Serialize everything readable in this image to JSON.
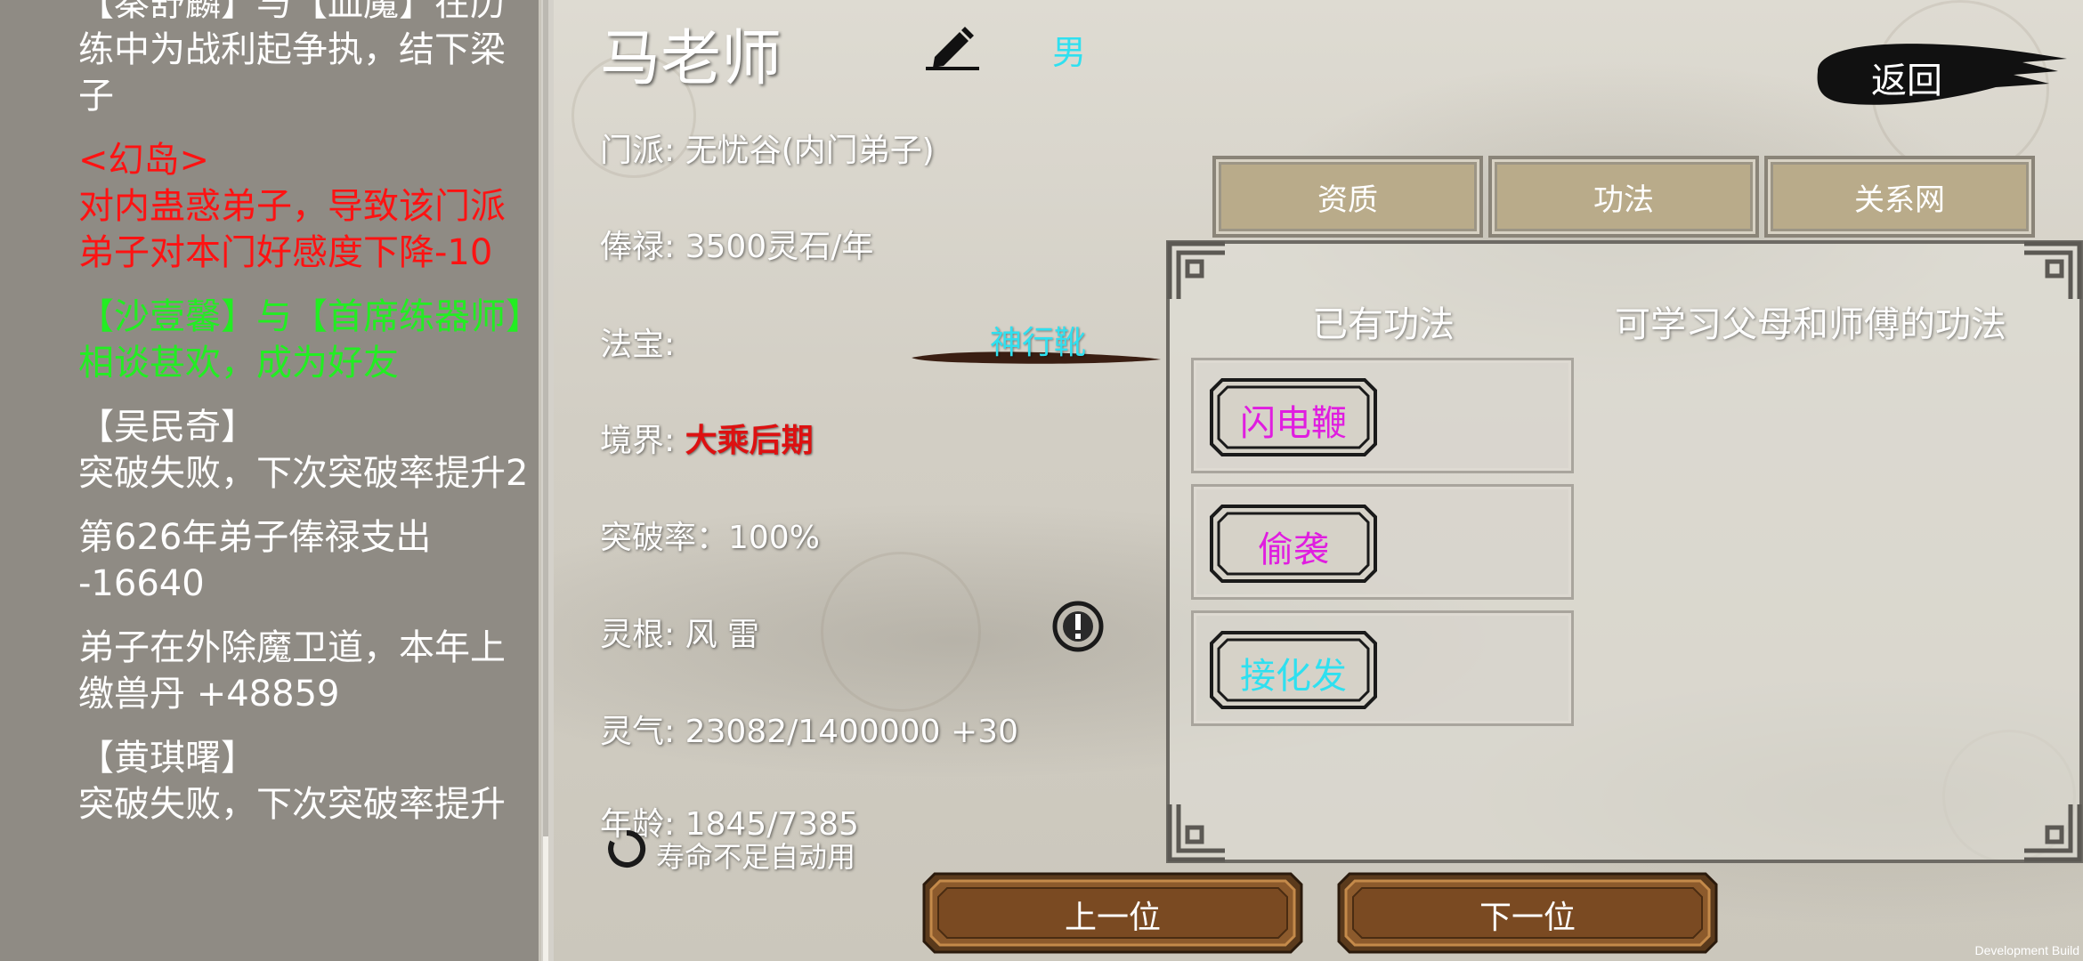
{
  "log": {
    "entries": [
      {
        "text": "【秦舒麟】与【血魔】在历练中为战利起争执，结下梁子",
        "color": "white"
      },
      {
        "text": "<幻岛>\n对内蛊惑弟子，导致该门派弟子对本门好感度下降-10",
        "color": "red"
      },
      {
        "text": "【沙壹馨】与【首席练器师】相谈甚欢，成为好友",
        "color": "green"
      },
      {
        "text": "【吴民奇】\n突破失败，下次突破率提升2",
        "color": "white"
      },
      {
        "text": "第626年弟子俸禄支出\n-16640",
        "color": "white"
      },
      {
        "text": "弟子在外除魔卫道，本年上缴兽丹 +48859",
        "color": "white"
      },
      {
        "text": "【黄琪曙】\n突破失败，下次突破率提升",
        "color": "white"
      }
    ]
  },
  "character": {
    "name": "马老师",
    "gender": "男",
    "sect": "门派: 无忧谷(内门弟子)",
    "salary": "俸禄: 3500灵石/年",
    "treasure_label": "法宝:",
    "treasure_name": "神行靴",
    "realm_label": "境界: ",
    "realm_value": "大乘后期",
    "breakthrough": "突破率：100%",
    "spirit_root": "灵根: 风 雷",
    "qi": "灵气: 23082/1400000 +30",
    "age": "年龄: 1845/7385",
    "auto_use_label": "寿命不足自动用"
  },
  "back_button": {
    "label": "返回"
  },
  "tabs": [
    {
      "label": "资质"
    },
    {
      "label": "功法"
    },
    {
      "label": "关系网"
    }
  ],
  "skills_panel": {
    "owned_title": "已有功法",
    "learnable_title": "可学习父母和师傅的功法",
    "owned": [
      {
        "name": "闪电鞭",
        "color": "#e01de0"
      },
      {
        "name": "偷袭",
        "color": "#e01de0"
      },
      {
        "name": "接化发",
        "color": "#2fe0f0"
      }
    ]
  },
  "nav": {
    "prev": "上一位",
    "next": "下一位"
  },
  "footer": {
    "dev_build": "Development Build"
  }
}
